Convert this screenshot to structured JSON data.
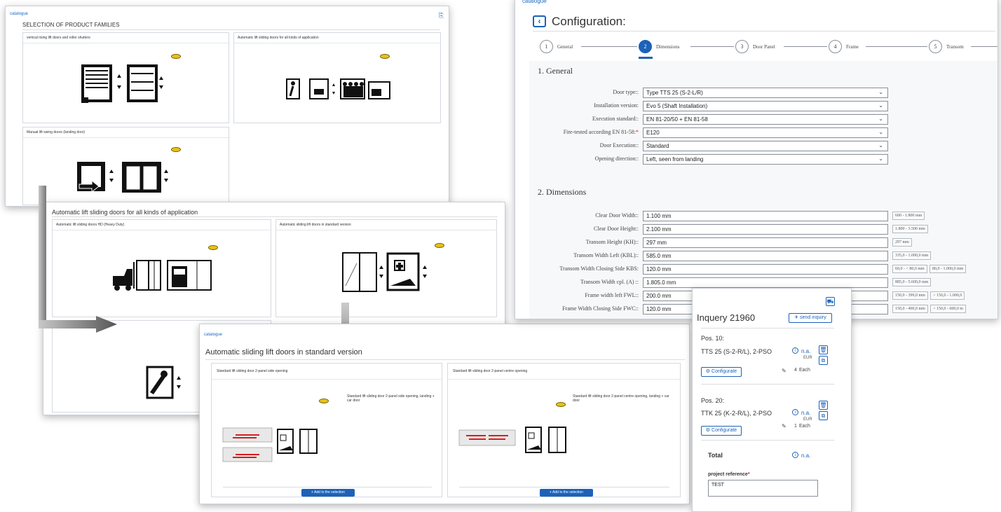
{
  "win1": {
    "breadcrumb": "catalogue",
    "heading": "SELECTION OF PRODUCT FAMILIES",
    "cards": [
      "vertical rising lift doors and roller shutters",
      "Automatic lift sliding doors for all kinds of application",
      "Manual lift swing doors (landing door)"
    ]
  },
  "win2": {
    "heading": "Automatic lift sliding doors for all kinds of application",
    "cards": [
      "Automatic lift sliding doors HD (Heavy Duty)",
      "Automatic sliding lift doors in standard version"
    ]
  },
  "win3": {
    "breadcrumb": "catalogue",
    "heading": "Automatic sliding lift doors in standard version",
    "cards": [
      {
        "title": "Standard lift sliding door 2-panel side opening",
        "desc": "Standard lift sliding door 2-panel side opening, landing + car door",
        "button": "+ Add to the selection"
      },
      {
        "title": "Standard lift sliding door 2-panel centre opening",
        "desc": "Standard lift sliding door 2-panel centre opening, landing + car door",
        "button": "+ Add to the selection"
      }
    ]
  },
  "win4": {
    "breadcrumb": "catalogue",
    "title": "Configuration:",
    "steps": [
      {
        "n": "1",
        "label": "General"
      },
      {
        "n": "2",
        "label": "Dimensions"
      },
      {
        "n": "3",
        "label": "Door Panel"
      },
      {
        "n": "4",
        "label": "Frame"
      },
      {
        "n": "5",
        "label": "Transom"
      }
    ],
    "section1": "1. General",
    "general": [
      {
        "label": "Door type::",
        "value": "Type TTS 25 (S-2-L/R)"
      },
      {
        "label": "Installation version:",
        "value": "Evo 5 (Shaft Installation)"
      },
      {
        "label": "Execution standard::",
        "value": "EN 81-20/50 + EN 81-58"
      },
      {
        "label": "Fire-tested according EN 81-58:",
        "value": "E120"
      },
      {
        "label": "Door Execution::",
        "value": "Standard"
      },
      {
        "label": "Opening direction::",
        "value": "Left, seen from landing"
      }
    ],
    "required_mark": "*",
    "section2": "2. Dimensions",
    "dims": [
      {
        "label": "Clear Door Width::",
        "value": "1.100 mm",
        "ranges": [
          "600 - 1.800 mm"
        ]
      },
      {
        "label": "Clear Door Height::",
        "value": "2.100 mm",
        "ranges": [
          "1.800 - 3.500 mm"
        ]
      },
      {
        "label": "Transom Height (KH)::",
        "value": "297 mm",
        "ranges": [
          "297 mm"
        ]
      },
      {
        "label": "Transom Width Left (KBL)::",
        "value": "585.0 mm",
        "ranges": [
          "335,0 - 1.000,0 mm"
        ]
      },
      {
        "label": "Transom Width Closing Side KBS:",
        "value": "120.0 mm",
        "ranges": [
          "60,0 - < 80,0 mm",
          "80,0 - 1.000,0 mm"
        ]
      },
      {
        "label": "Transom Width cpl. (A) ::",
        "value": "1.805.0 mm",
        "ranges": [
          "885,0 - 5.600,0 mm"
        ]
      },
      {
        "label": "Frame width left FWL::",
        "value": "200.0 mm",
        "ranges": [
          "150,0 - 399,0 mm",
          "> 150,0 - 1.000,0"
        ]
      },
      {
        "label": "Frame Width Closing Side FWC::",
        "value": "120.0 mm",
        "ranges": [
          "150,0 - 400,0 mm",
          "> 150,0 - 600,0 m"
        ]
      }
    ]
  },
  "win5": {
    "title": "Inquery 21960",
    "send": "send inquiry",
    "positions": [
      {
        "pos": "Pos. 10:",
        "name": "TTS 25 (S-2-R/L), 2-PSO",
        "price": "n.a.",
        "cur": "EUR",
        "qty": "4",
        "unit": "Each",
        "configure": "Configurate"
      },
      {
        "pos": "Pos. 20:",
        "name": "TTK 25 (K-2-R/L), 2-PSO",
        "price": "n.a.",
        "cur": "EUR",
        "qty": "1",
        "unit": "Each",
        "configure": "Configurate"
      }
    ],
    "total_label": "Total",
    "total_value": "n.a.",
    "ref_label": "project reference",
    "ref_req": "*",
    "ref_value": "TEST"
  }
}
